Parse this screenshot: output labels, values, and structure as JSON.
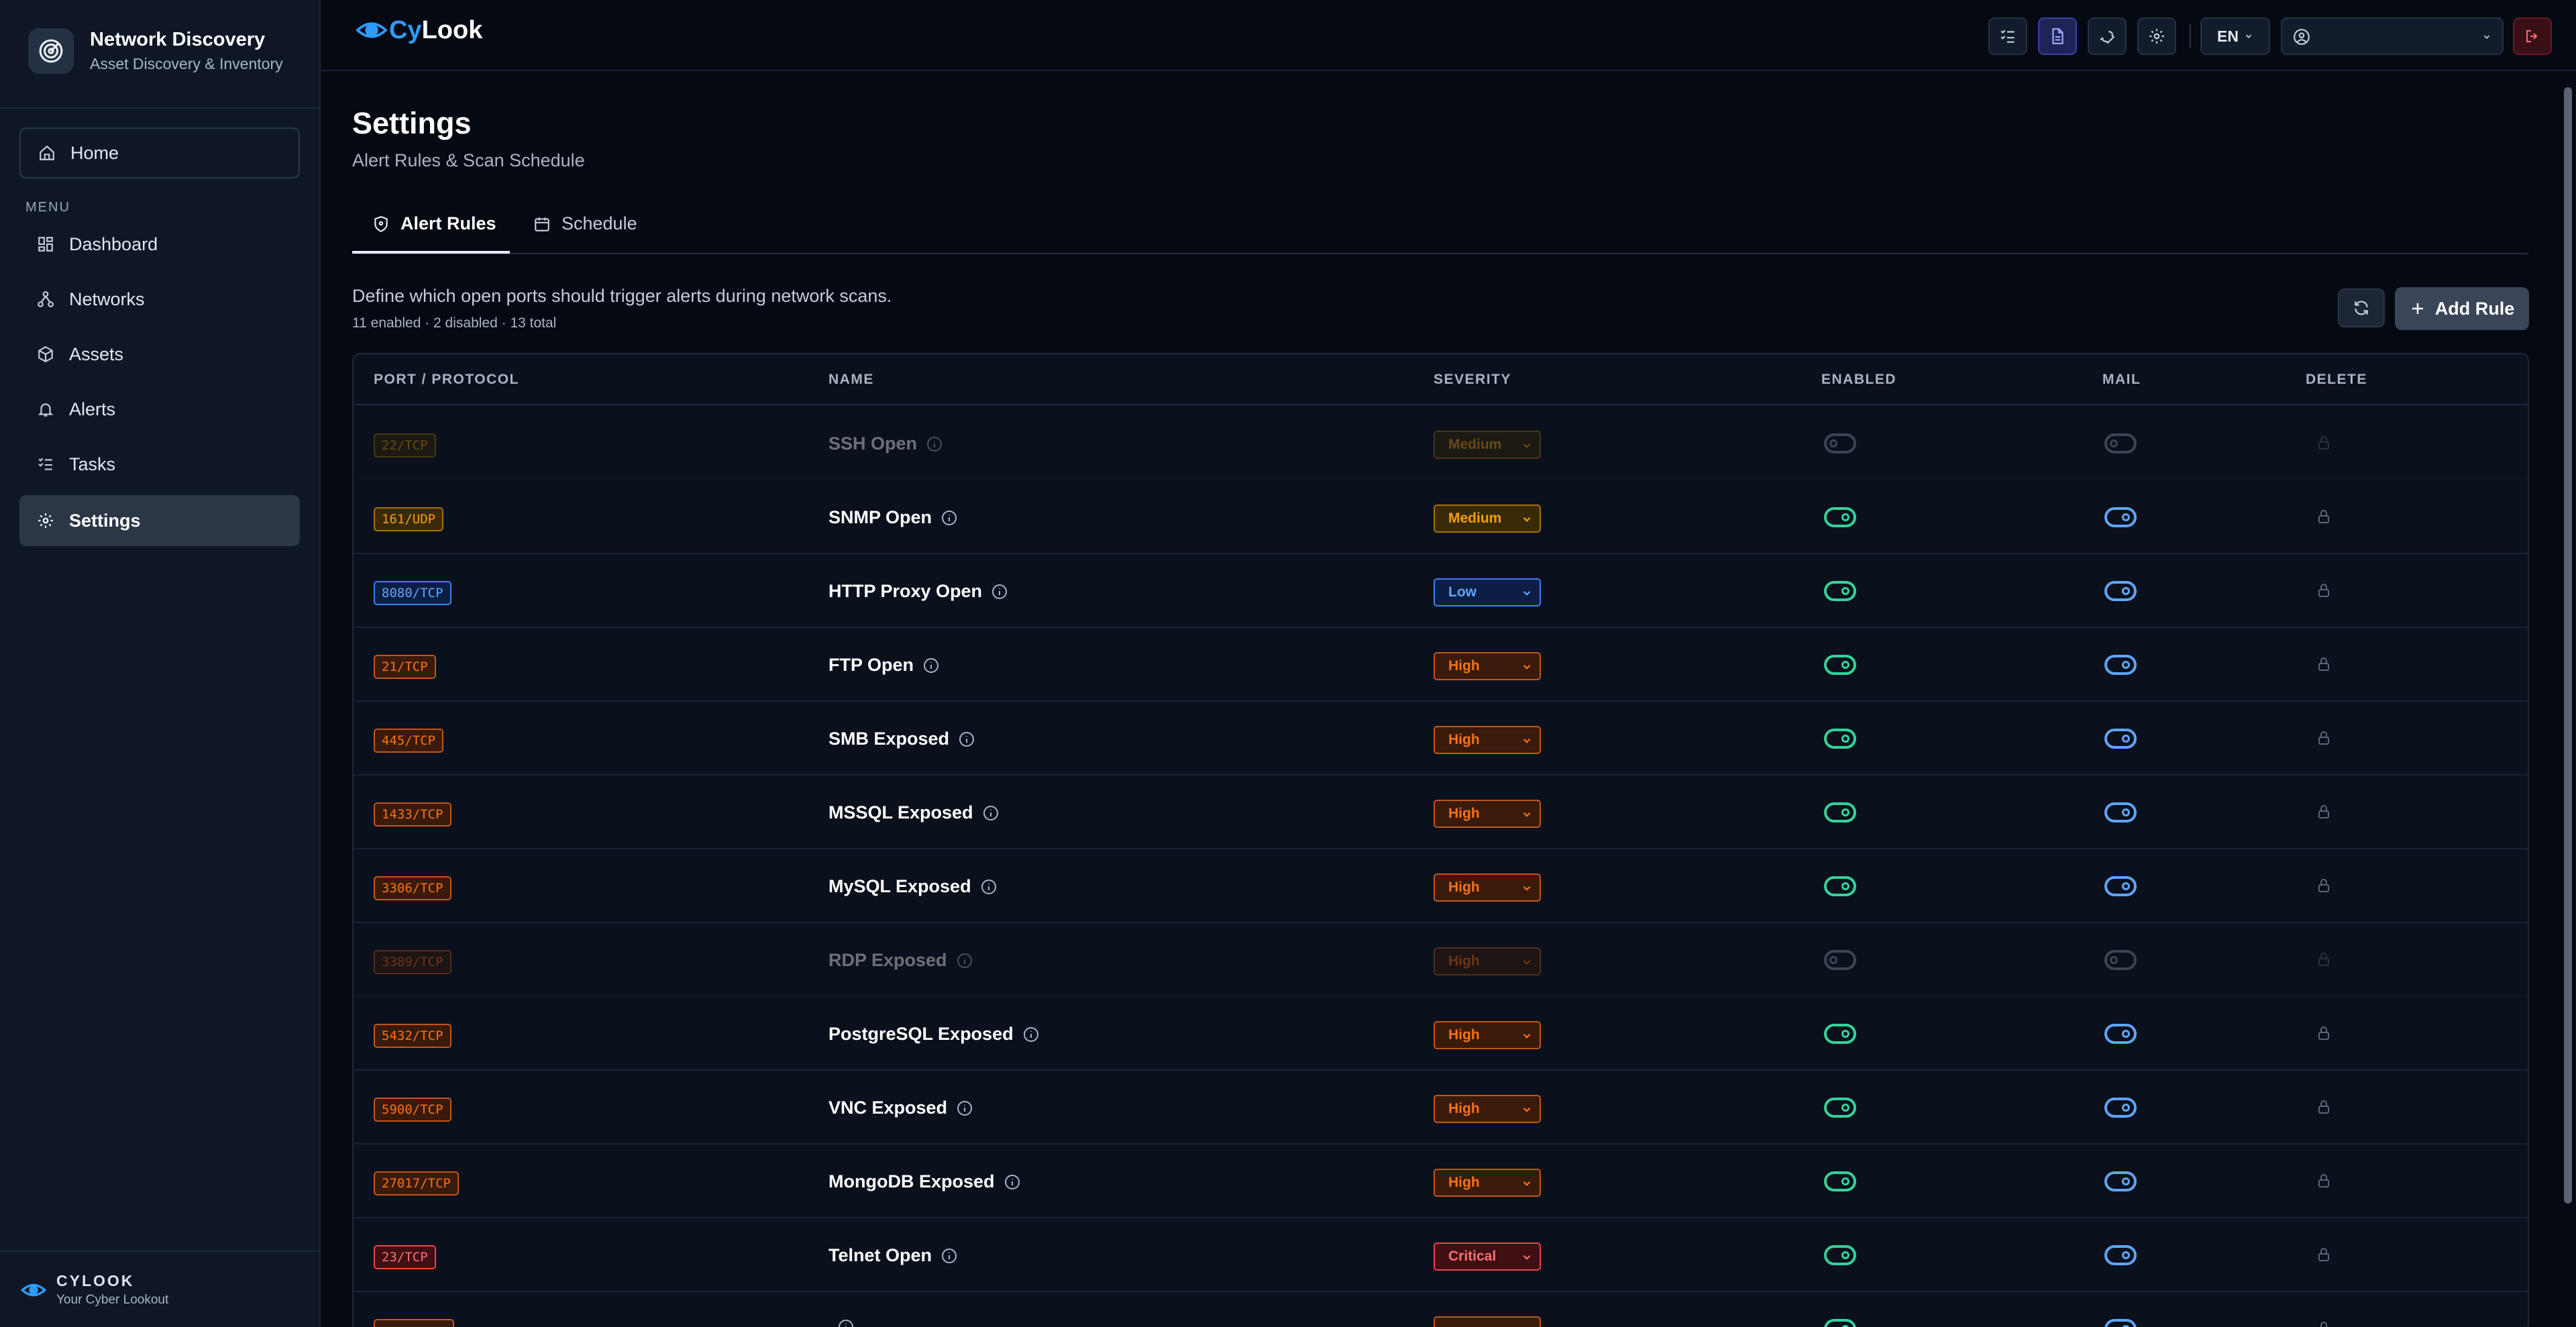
{
  "sidebar": {
    "brand_title": "Network Discovery",
    "brand_subtitle": "Asset Discovery & Inventory",
    "home_label": "Home",
    "menu_label": "MENU",
    "items": [
      {
        "label": "Dashboard",
        "icon": "dashboard-icon"
      },
      {
        "label": "Networks",
        "icon": "network-icon"
      },
      {
        "label": "Assets",
        "icon": "box-icon"
      },
      {
        "label": "Alerts",
        "icon": "bell-icon"
      },
      {
        "label": "Tasks",
        "icon": "list-icon"
      },
      {
        "label": "Settings",
        "icon": "gear-icon",
        "active": true
      }
    ],
    "footer_title": "CYLOOK",
    "footer_subtitle": "Your Cyber Lookout"
  },
  "topbar": {
    "logo_cy": "Cy",
    "logo_look": "Look",
    "language": "EN"
  },
  "page": {
    "title": "Settings",
    "subtitle": "Alert Rules & Scan Schedule",
    "tabs": [
      {
        "label": "Alert Rules",
        "active": true
      },
      {
        "label": "Schedule",
        "active": false
      }
    ],
    "description": "Define which open ports should trigger alerts during network scans.",
    "counts": "11 enabled · 2 disabled · 13 total",
    "add_rule_label": "Add Rule"
  },
  "table": {
    "headers": [
      "PORT / PROTOCOL",
      "NAME",
      "SEVERITY",
      "ENABLED",
      "MAIL",
      "DELETE"
    ],
    "rows": [
      {
        "port": "22/TCP",
        "name": "SSH Open",
        "severity": "Medium",
        "enabled": false,
        "mail": false
      },
      {
        "port": "161/UDP",
        "name": "SNMP Open",
        "severity": "Medium",
        "enabled": true,
        "mail": true
      },
      {
        "port": "8080/TCP",
        "name": "HTTP Proxy Open",
        "severity": "Low",
        "enabled": true,
        "mail": true
      },
      {
        "port": "21/TCP",
        "name": "FTP Open",
        "severity": "High",
        "enabled": true,
        "mail": true
      },
      {
        "port": "445/TCP",
        "name": "SMB Exposed",
        "severity": "High",
        "enabled": true,
        "mail": true
      },
      {
        "port": "1433/TCP",
        "name": "MSSQL Exposed",
        "severity": "High",
        "enabled": true,
        "mail": true
      },
      {
        "port": "3306/TCP",
        "name": "MySQL Exposed",
        "severity": "High",
        "enabled": true,
        "mail": true
      },
      {
        "port": "3389/TCP",
        "name": "RDP Exposed",
        "severity": "High",
        "enabled": false,
        "mail": false
      },
      {
        "port": "5432/TCP",
        "name": "PostgreSQL Exposed",
        "severity": "High",
        "enabled": true,
        "mail": true
      },
      {
        "port": "5900/TCP",
        "name": "VNC Exposed",
        "severity": "High",
        "enabled": true,
        "mail": true
      },
      {
        "port": "27017/TCP",
        "name": "MongoDB Exposed",
        "severity": "High",
        "enabled": true,
        "mail": true
      },
      {
        "port": "23/TCP",
        "name": "Telnet Open",
        "severity": "Critical",
        "enabled": true,
        "mail": true
      },
      {
        "port": "",
        "name": "",
        "severity": "",
        "enabled": true,
        "mail": true
      }
    ]
  },
  "colors": {
    "medium": "#f59e0b",
    "low": "#3b82f6",
    "high": "#f97316",
    "critical": "#ef4444",
    "toggle_enabled": "#34d399",
    "toggle_mail": "#60a5fa"
  }
}
